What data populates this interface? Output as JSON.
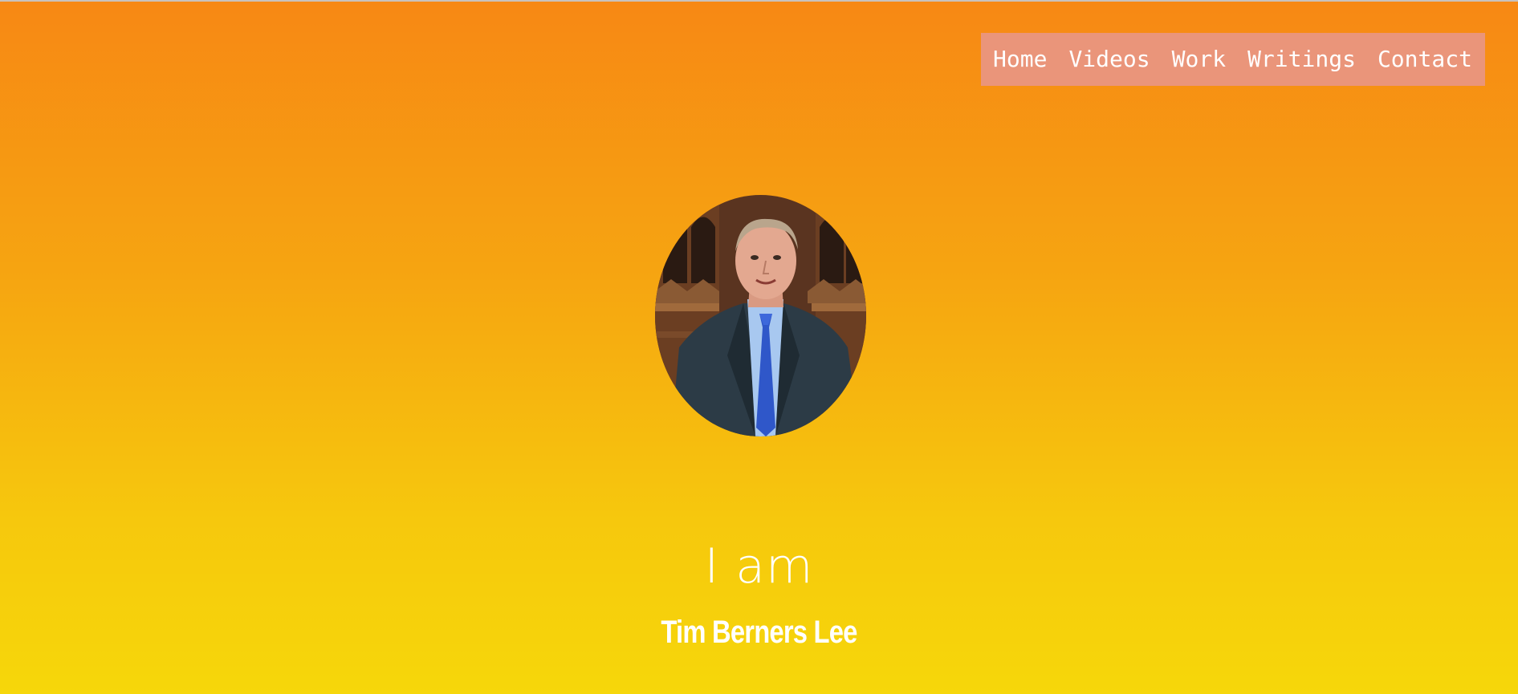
{
  "nav": {
    "items": [
      {
        "label": "Home"
      },
      {
        "label": "Videos"
      },
      {
        "label": "Work"
      },
      {
        "label": "Writings"
      },
      {
        "label": "Contact"
      }
    ]
  },
  "hero": {
    "intro": "I am",
    "name": "Tim Berners Lee"
  },
  "colors": {
    "gradient_top": "#f78814",
    "gradient_bottom": "#f6d70a",
    "nav_background": "#ea957a",
    "text": "#ffffff"
  }
}
